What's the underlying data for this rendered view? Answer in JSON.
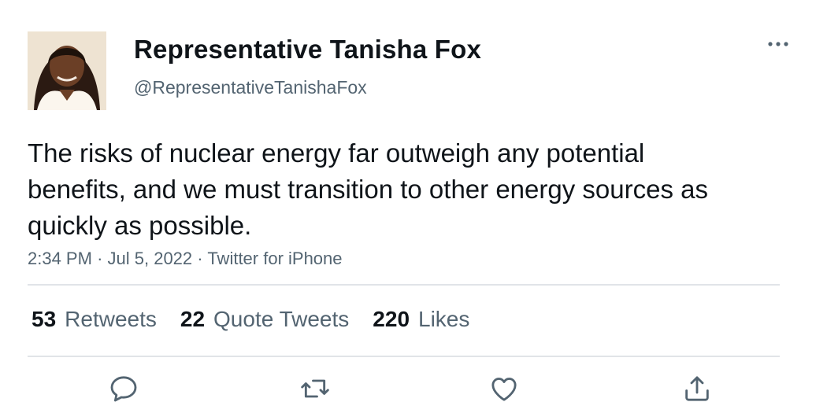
{
  "user": {
    "display_name": "Representative Tanisha Fox",
    "handle": "@RepresentativeTanishaFox"
  },
  "tweet": {
    "text": "The risks of nuclear energy far outweigh any potential benefits, and we must transition to other energy sources as quickly as possible.",
    "time": "2:34 PM",
    "separator": "·",
    "date": "Jul 5, 2022",
    "source": "Twitter for iPhone"
  },
  "stats": {
    "retweets": {
      "count": "53",
      "label": "Retweets"
    },
    "quotes": {
      "count": "22",
      "label": "Quote Tweets"
    },
    "likes": {
      "count": "220",
      "label": "Likes"
    }
  },
  "icons": {
    "more": "more-horizontal-icon",
    "reply": "reply-icon",
    "retweet": "retweet-icon",
    "like": "heart-icon",
    "share": "share-icon"
  },
  "colors": {
    "text": "#0f1419",
    "secondary": "#536471",
    "divider": "#e1e4e8"
  }
}
